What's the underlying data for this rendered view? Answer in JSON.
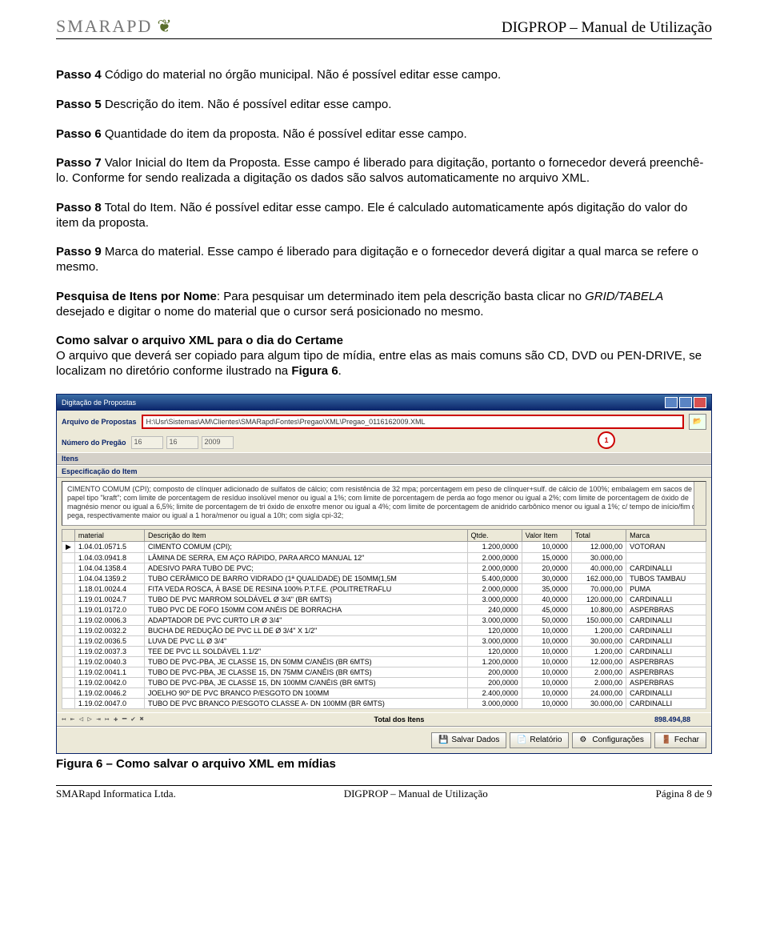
{
  "header": {
    "logo_text": "SMARAPD",
    "doc_title": "DIGPROP – Manual de Utilização"
  },
  "body": {
    "p1": {
      "lead": "Passo 4",
      "text": " Código do material no órgão municipal. Não é possível editar esse campo."
    },
    "p2": {
      "lead": "Passo 5",
      "text": " Descrição do item. Não é possível editar esse campo."
    },
    "p3": {
      "lead": "Passo 6",
      "text": " Quantidade do item da proposta. Não é possível editar esse campo."
    },
    "p4": {
      "lead": "Passo 7",
      "text": " Valor Inicial do Item da Proposta. Esse campo é liberado para digitação, portanto o fornecedor deverá preenchê-lo. Conforme for sendo realizada a digitação os dados são salvos automaticamente no arquivo XML."
    },
    "p5": {
      "lead": "Passo 8",
      "text": " Total do Item. Não é possível editar esse campo. Ele é calculado automaticamente após digitação do valor do item da proposta."
    },
    "p6": {
      "lead": "Passo 9",
      "text": " Marca do material. Esse campo é liberado para digitação e o fornecedor deverá digitar a qual marca se refere o mesmo."
    },
    "p7": {
      "lead": "Pesquisa de Itens por Nome",
      "text": ": Para pesquisar um determinado item pela descrição basta clicar no ",
      "italic": "GRID/TABELA",
      "tail": " desejado e digitar o nome do material que o cursor será posicionado no mesmo."
    },
    "p8": {
      "lead": "Como salvar o arquivo XML para o dia do Certame",
      "text": "O arquivo que deverá ser copiado para algum tipo de mídia, entre elas as mais comuns são CD, DVD ou PEN-DRIVE, se localizam no diretório conforme ilustrado na ",
      "bold_tail": "Figura 6",
      "end": "."
    }
  },
  "screenshot": {
    "win_title": "Digitação de Propostas",
    "arquivo_label": "Arquivo de Propostas",
    "arquivo_path": "H:\\Usr\\Sistemas\\AM\\Clientes\\SMARapd\\Fontes\\Pregao\\XML\\Pregao_0116162009.XML",
    "numero_label": "Número do Pregão",
    "numero": [
      "16",
      "16",
      "2009"
    ],
    "callout": "1",
    "itens_label": "Itens",
    "espec_label": "Especificação do Item",
    "espec_text": "CIMENTO COMUM (CPI); composto de clínquer adicionado de sulfatos de cálcio; com resistência de 32 mpa; porcentagem em peso de clínquer+sulf. de cálcio de 100%; embalagem em sacos de papel tipo \"kraft\"; com limite de porcentagem de resíduo insolúvel menor ou igual a 1%; com limite de porcentagem de perda ao fogo menor ou igual a 2%; com limite de porcentagem de óxido de magnésio menor ou igual a 6,5%; limite de porcentagem de tri óxido de enxofre menor ou igual a 4%; com limite de porcentagem de anidrido carbônico menor ou igual a 1%; c/ tempo de início/fim de pega, respectivamente maior ou igual a 1 hora/menor ou igual a 10h; com sigla cpi-32;",
    "cols": [
      "material",
      "Descrição do Item",
      "Qtde.",
      "Valor Item",
      "Total",
      "Marca"
    ],
    "rows": [
      [
        "1.04.01.0571.5",
        "CIMENTO COMUM (CPI);",
        "1.200,0000",
        "10,0000",
        "12.000,00",
        "VOTORAN"
      ],
      [
        "1.04.03.0941.8",
        "LÂMINA DE SERRA, EM AÇO RÁPIDO, PARA ARCO MANUAL 12\"",
        "2.000,0000",
        "15,0000",
        "30.000,00",
        ""
      ],
      [
        "1.04.04.1358.4",
        "ADESIVO PARA TUBO DE PVC;",
        "2.000,0000",
        "20,0000",
        "40.000,00",
        "CARDINALLI"
      ],
      [
        "1.04.04.1359.2",
        "TUBO CERÂMICO DE BARRO VIDRADO (1ª QUALIDADE) DE 150MM(1,5M",
        "5.400,0000",
        "30,0000",
        "162.000,00",
        "TUBOS TAMBAU"
      ],
      [
        "1.18.01.0024.4",
        "FITA VEDA ROSCA, À BASE DE RESINA 100% P.T.F.E. (POLITRETRAFLU",
        "2.000,0000",
        "35,0000",
        "70.000,00",
        "PUMA"
      ],
      [
        "1.19.01.0024.7",
        "TUBO DE PVC MARROM SOLDÁVEL Ø 3/4\" (BR 6MTS)",
        "3.000,0000",
        "40,0000",
        "120.000,00",
        "CARDINALLI"
      ],
      [
        "1.19.01.0172.0",
        "TUBO PVC DE FOFO 150MM COM ANÉIS DE BORRACHA",
        "240,0000",
        "45,0000",
        "10.800,00",
        "ASPERBRAS"
      ],
      [
        "1.19.02.0006.3",
        "ADAPTADOR DE PVC CURTO LR Ø 3/4\"",
        "3.000,0000",
        "50,0000",
        "150.000,00",
        "CARDINALLI"
      ],
      [
        "1.19.02.0032.2",
        "BUCHA DE REDUÇÃO DE PVC LL DE Ø 3/4\" X 1/2\"",
        "120,0000",
        "10,0000",
        "1.200,00",
        "CARDINALLI"
      ],
      [
        "1.19.02.0036.5",
        "LUVA DE PVC LL Ø 3/4\"",
        "3.000,0000",
        "10,0000",
        "30.000,00",
        "CARDINALLI"
      ],
      [
        "1.19.02.0037.3",
        "TEE DE PVC LL SOLDÁVEL 1.1/2\"",
        "120,0000",
        "10,0000",
        "1.200,00",
        "CARDINALLI"
      ],
      [
        "1.19.02.0040.3",
        "TUBO DE PVC-PBA, JE CLASSE 15, DN 50MM C/ANÉIS (BR 6MTS)",
        "1.200,0000",
        "10,0000",
        "12.000,00",
        "ASPERBRAS"
      ],
      [
        "1.19.02.0041.1",
        "TUBO DE PVC-PBA, JE CLASSE 15, DN 75MM C/ANÉIS (BR 6MTS)",
        "200,0000",
        "10,0000",
        "2.000,00",
        "ASPERBRAS"
      ],
      [
        "1.19.02.0042.0",
        "TUBO DE PVC-PBA, JE CLASSE 15, DN 100MM C/ANÉIS (BR 6MTS)",
        "200,0000",
        "10,0000",
        "2.000,00",
        "ASPERBRAS"
      ],
      [
        "1.19.02.0046.2",
        "JOELHO 90º DE PVC BRANCO P/ESGOTO DN 100MM",
        "2.400,0000",
        "10,0000",
        "24.000,00",
        "CARDINALLI"
      ],
      [
        "1.19.02.0047.0",
        "TUBO DE PVC BRANCO P/ESGOTO CLASSE A- DN 100MM (BR 6MTS)",
        "3.000,0000",
        "10,0000",
        "30.000,00",
        "CARDINALLI"
      ]
    ],
    "nav_glyphs": "↤  ⇤  ◁  ▷  ⇥  ↦   ✚  ━  ✔  ✖",
    "total_label": "Total dos Itens",
    "total_value": "898.494,88",
    "btn_salvar": "Salvar Dados",
    "btn_relatorio": "Relatório",
    "btn_config": "Configurações",
    "btn_fechar": "Fechar"
  },
  "figure_caption": "Figura 6 – Como salvar o arquivo XML em mídias",
  "footer": {
    "left": "SMARapd Informatica Ltda.",
    "center": "DIGPROP – Manual de Utilização",
    "right": "Página 8 de 9"
  }
}
